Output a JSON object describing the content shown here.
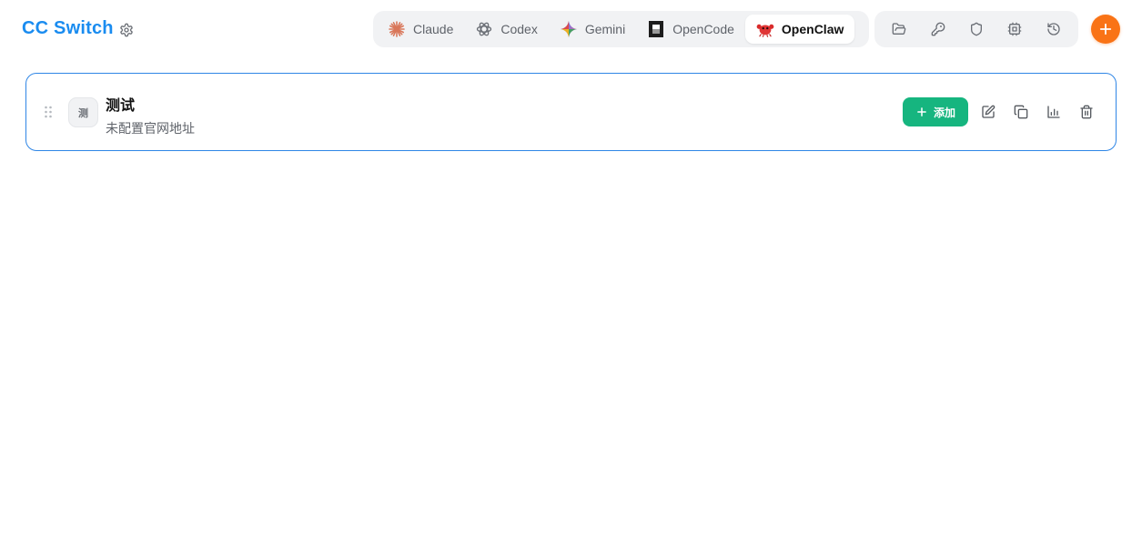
{
  "app": {
    "title": "CC Switch"
  },
  "tabs": [
    {
      "label": "Claude",
      "icon": "claude-asterisk-icon",
      "active": false
    },
    {
      "label": "Codex",
      "icon": "codex-knot-icon",
      "active": false
    },
    {
      "label": "Gemini",
      "icon": "gemini-sparkle-icon",
      "active": false
    },
    {
      "label": "OpenCode",
      "icon": "opencode-square-icon",
      "active": false
    },
    {
      "label": "OpenClaw",
      "icon": "openclaw-crab-icon",
      "active": true
    }
  ],
  "toolbar": {
    "icons": [
      "folder-open-icon",
      "key-icon",
      "shield-icon",
      "cpu-chip-icon",
      "history-icon"
    ]
  },
  "provider": {
    "avatar_text": "测",
    "name": "测试",
    "url_text": "未配置官网地址",
    "add_label": "添加"
  },
  "colors": {
    "brand": "#1a8cf0",
    "accent_orange": "#f97316",
    "accent_green": "#16b57f",
    "card_border": "#2f86e6"
  }
}
